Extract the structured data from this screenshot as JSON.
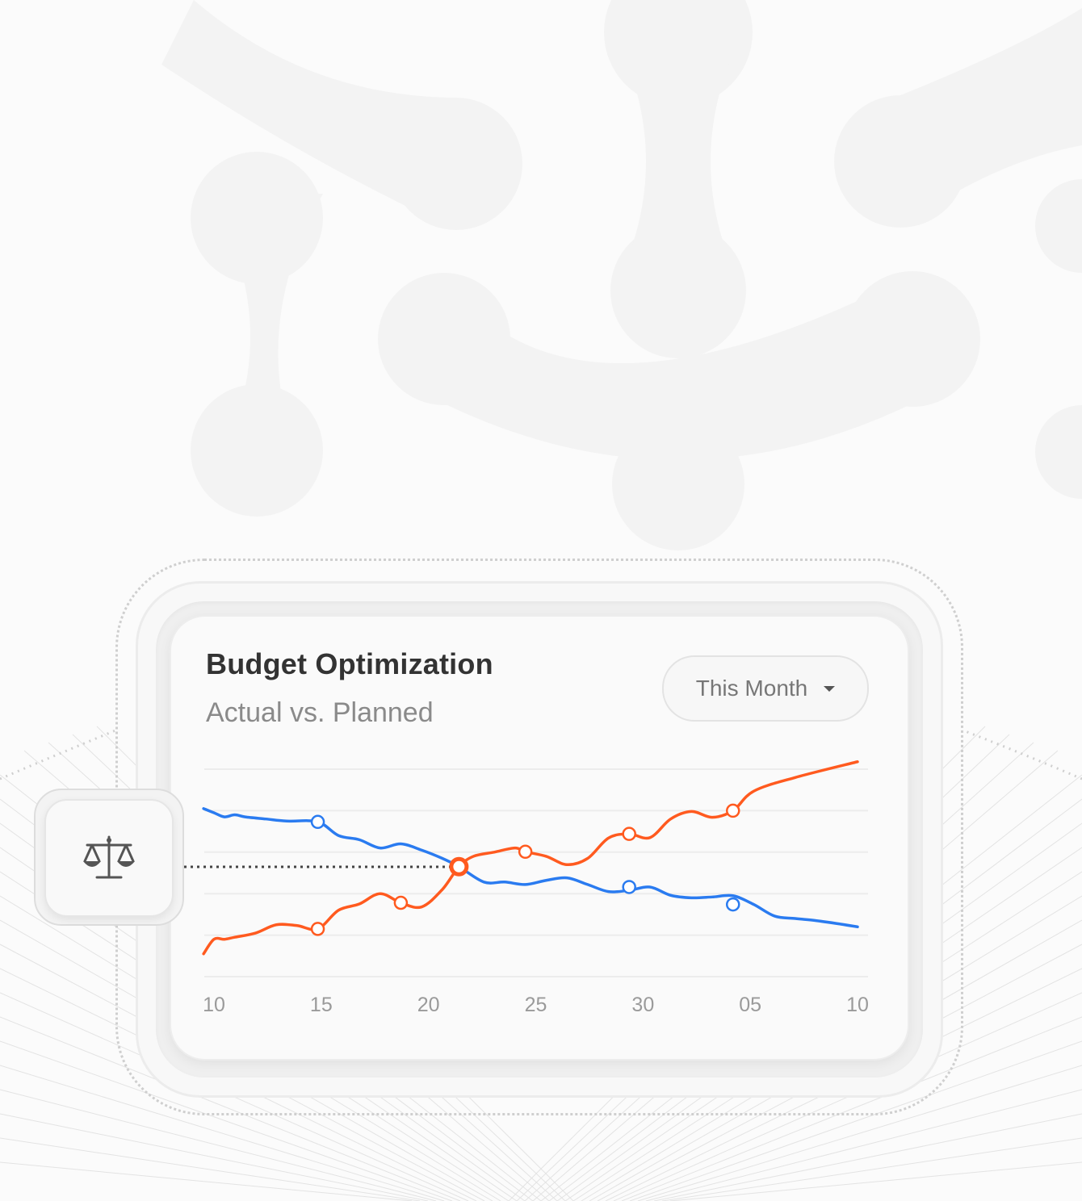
{
  "card": {
    "title": "Budget Optimization",
    "subtitle": "Actual vs. Planned",
    "period": "This Month"
  },
  "icon": {
    "name": "scale-balance-icon"
  },
  "colors": {
    "actual": "#ff5a1f",
    "planned": "#2a7bf0",
    "grid": "#ececec",
    "text": "#333333"
  },
  "chart_data": {
    "type": "line",
    "title": "Budget Optimization",
    "subtitle": "Actual vs. Planned",
    "x_ticks": [
      "10",
      "15",
      "20",
      "25",
      "30",
      "05",
      "10"
    ],
    "x_range": [
      0,
      31
    ],
    "y_range": [
      0,
      5
    ],
    "grid": true,
    "series": [
      {
        "color": "#2a7bf0",
        "points": [
          [
            -0.5,
            4.05
          ],
          [
            0,
            3.95
          ],
          [
            0.5,
            3.85
          ],
          [
            1,
            3.9
          ],
          [
            1.5,
            3.85
          ],
          [
            2.5,
            3.8
          ],
          [
            3.5,
            3.75
          ],
          [
            5,
            3.73
          ],
          [
            6,
            3.4
          ],
          [
            7,
            3.3
          ],
          [
            8,
            3.1
          ],
          [
            9,
            3.2
          ],
          [
            10,
            3.05
          ],
          [
            11,
            2.85
          ],
          [
            11.8,
            2.65
          ],
          [
            13,
            2.28
          ],
          [
            14,
            2.28
          ],
          [
            15,
            2.22
          ],
          [
            16,
            2.32
          ],
          [
            17,
            2.38
          ],
          [
            18,
            2.22
          ],
          [
            19,
            2.05
          ],
          [
            20,
            2.08
          ],
          [
            21,
            2.16
          ],
          [
            22,
            1.96
          ],
          [
            23,
            1.9
          ],
          [
            24,
            1.92
          ],
          [
            25,
            1.95
          ],
          [
            26,
            1.74
          ],
          [
            27,
            1.46
          ],
          [
            28,
            1.4
          ],
          [
            29,
            1.35
          ],
          [
            30,
            1.28
          ],
          [
            31,
            1.2
          ]
        ],
        "markers": [
          [
            5,
            3.73
          ],
          [
            20,
            2.16
          ],
          [
            25,
            1.74
          ]
        ]
      },
      {
        "color": "#ff5a1f",
        "points": [
          [
            -0.5,
            0.55
          ],
          [
            0,
            0.9
          ],
          [
            0.5,
            0.9
          ],
          [
            1,
            0.95
          ],
          [
            2,
            1.05
          ],
          [
            3,
            1.25
          ],
          [
            4,
            1.23
          ],
          [
            5,
            1.15
          ],
          [
            6,
            1.6
          ],
          [
            7,
            1.75
          ],
          [
            8,
            2.0
          ],
          [
            9,
            1.78
          ],
          [
            10,
            1.68
          ],
          [
            11,
            2.1
          ],
          [
            11.8,
            2.65
          ],
          [
            12.5,
            2.9
          ],
          [
            13.5,
            3.0
          ],
          [
            14.5,
            3.1
          ],
          [
            15,
            3.01
          ],
          [
            16,
            2.9
          ],
          [
            17,
            2.7
          ],
          [
            18,
            2.85
          ],
          [
            19,
            3.34
          ],
          [
            20,
            3.44
          ],
          [
            21,
            3.35
          ],
          [
            22,
            3.8
          ],
          [
            23,
            3.98
          ],
          [
            24,
            3.84
          ],
          [
            25,
            4.0
          ],
          [
            26,
            4.47
          ],
          [
            28,
            4.8
          ],
          [
            31,
            5.18
          ]
        ],
        "markers": [
          [
            5,
            1.15
          ],
          [
            9,
            1.78
          ],
          [
            15,
            3.01
          ],
          [
            20,
            3.44
          ],
          [
            25,
            4.0
          ]
        ]
      }
    ],
    "highlight": {
      "x": 11.8,
      "y": 2.65
    }
  }
}
